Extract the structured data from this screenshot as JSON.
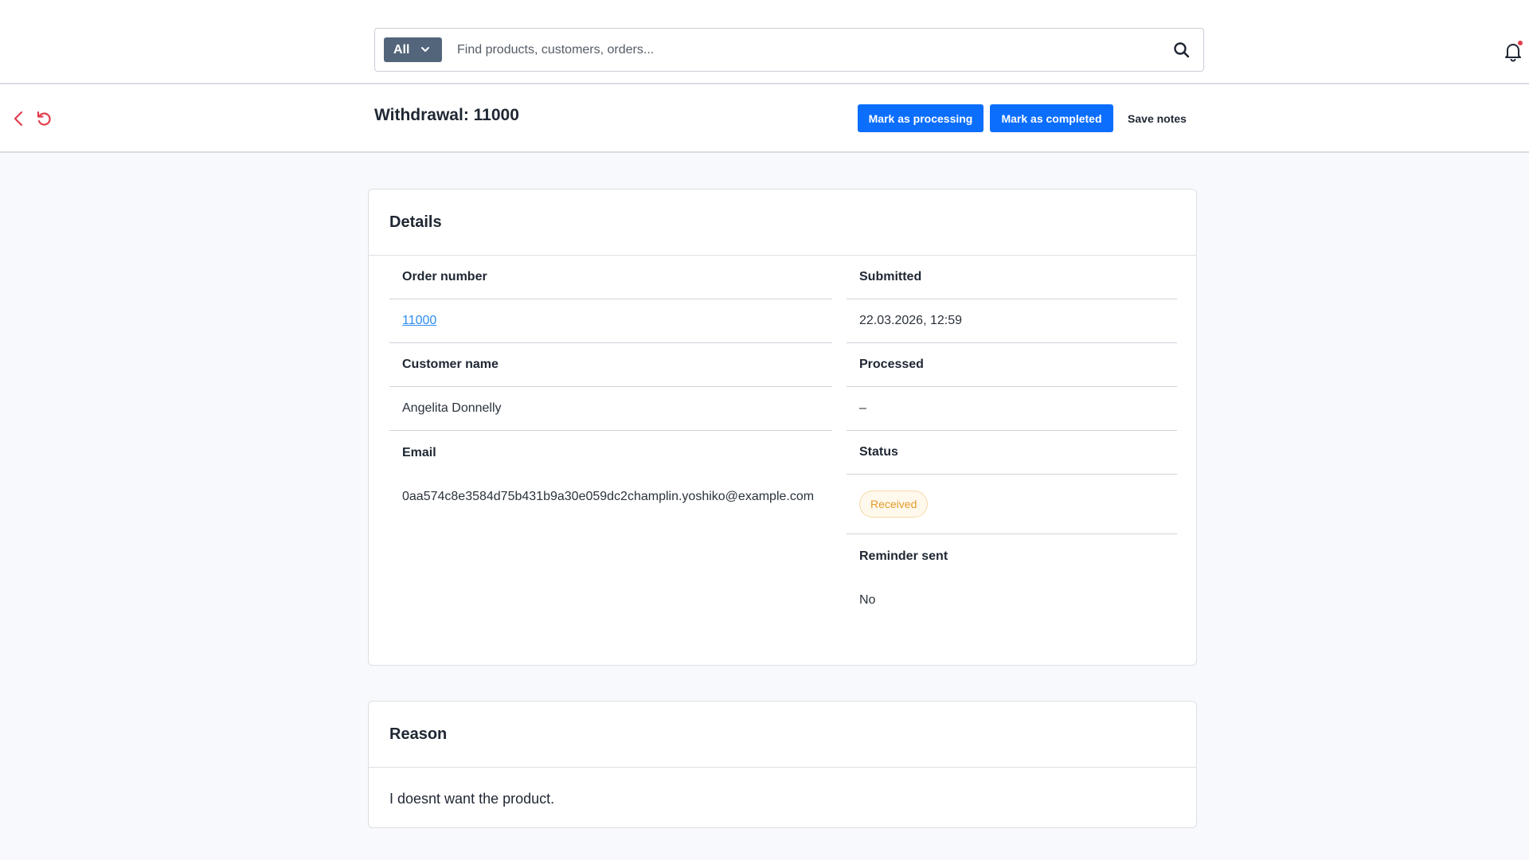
{
  "search": {
    "scope_label": "All",
    "placeholder": "Find products, customers, orders...",
    "value": ""
  },
  "header": {
    "title": "Withdrawal: 11000",
    "actions": {
      "mark_processing": "Mark as processing",
      "mark_completed": "Mark as completed",
      "save_notes": "Save notes"
    }
  },
  "details": {
    "title": "Details",
    "order_number_label": "Order number",
    "order_number": "11000",
    "customer_name_label": "Customer name",
    "customer_name": "Angelita Donnelly",
    "email_label": "Email",
    "email": "0aa574c8e3584d75b431b9a30e059dc2champlin.yoshiko@example.com",
    "submitted_label": "Submitted",
    "submitted": "22.03.2026, 12:59",
    "processed_label": "Processed",
    "processed": "–",
    "status_label": "Status",
    "status": "Received",
    "reminder_label": "Reminder sent",
    "reminder": "No"
  },
  "reason": {
    "title": "Reason",
    "text": "I doesnt want the product."
  },
  "colors": {
    "primary": "#0b6efd",
    "danger": "#e23d4b",
    "link": "#2f8cf0",
    "badge_text": "#e29b2b",
    "badge_bg": "#fff8ec",
    "scope_bg": "#52657b",
    "notification_dot": "#e23d4b"
  },
  "icons": {
    "search": "search-icon",
    "bell": "bell-icon",
    "back": "chevron-left-icon",
    "reload": "reload-icon",
    "scope": "chevron-down-icon"
  }
}
